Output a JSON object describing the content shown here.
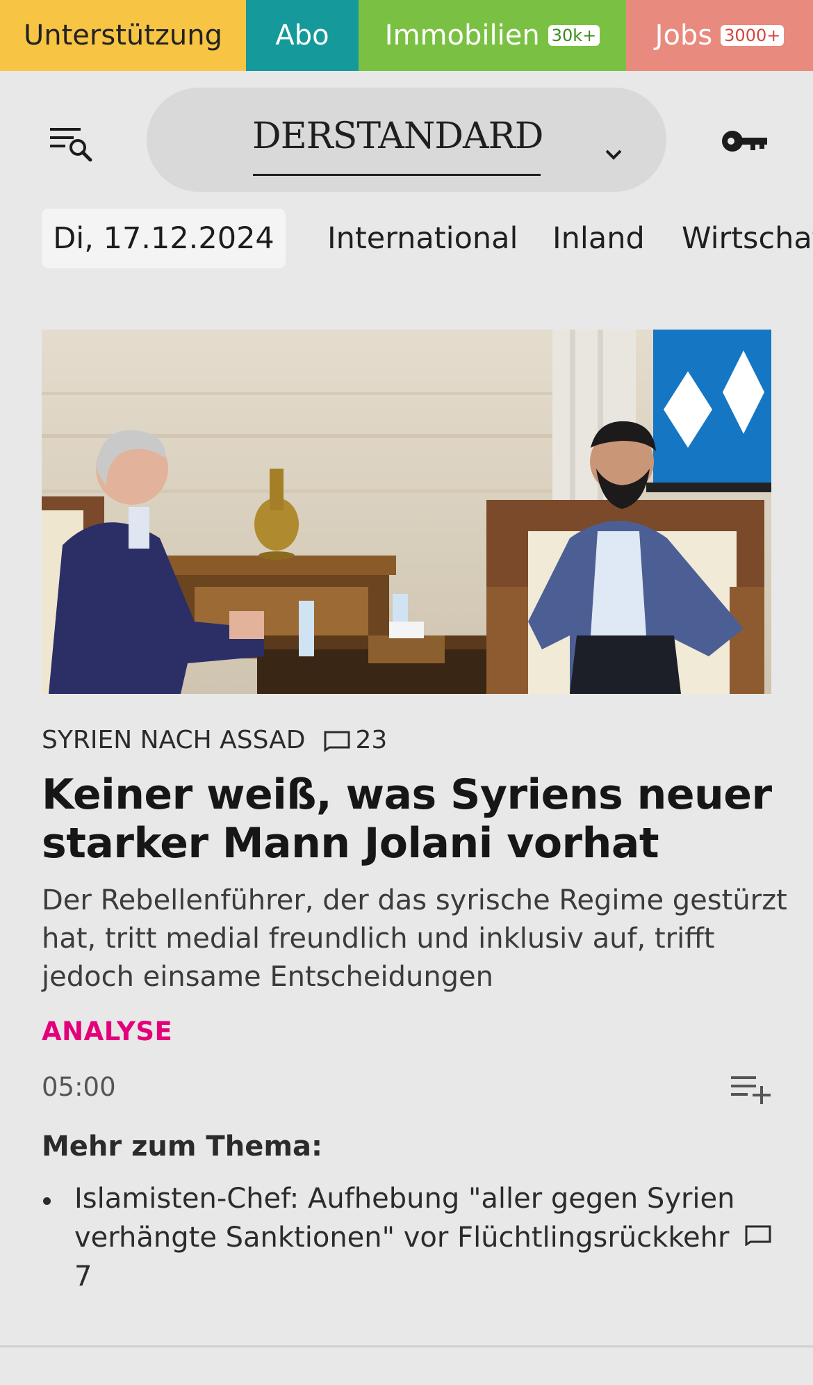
{
  "topbar": {
    "support_label": "Unterstützung",
    "abo_label": "Abo",
    "immobilien_label": "Immobilien",
    "immobilien_badge": "30k+",
    "jobs_label": "Jobs",
    "jobs_badge": "3000+"
  },
  "header": {
    "logo_text": "DERSTANDARD",
    "menu_icon": "menu-search-icon",
    "account_icon": "key-icon",
    "dropdown_icon": "chevron-down-icon"
  },
  "nav": {
    "date": "Di, 17.12.2024",
    "items": [
      "International",
      "Inland",
      "Wirtschaf"
    ]
  },
  "article": {
    "kicker": "SYRIEN NACH ASSAD",
    "comment_count": "23",
    "headline": "Keiner weiß, was Syriens neuer starker Mann Jolani vorhat",
    "teaser": "Der Rebellenführer, der das syrische Regime gestürzt hat, tritt medial freundlich und inklusiv auf, trifft jedoch einsame Entscheidungen",
    "label": "ANALYSE",
    "time": "05:00",
    "playlist_icon": "playlist-add-icon"
  },
  "more": {
    "title": "Mehr zum Thema:",
    "items": [
      {
        "text": "Islamisten-Chef: Aufhebung \"aller gegen Syrien verhängte Sanktionen\" vor Flüchtlingsrückkehr",
        "comments": "7"
      }
    ]
  },
  "colors": {
    "support": "#f7c543",
    "abo": "#16999a",
    "immobilien": "#7ac143",
    "jobs": "#e88a7e",
    "analyse": "#e3007a",
    "background": "#e8e8e8"
  }
}
